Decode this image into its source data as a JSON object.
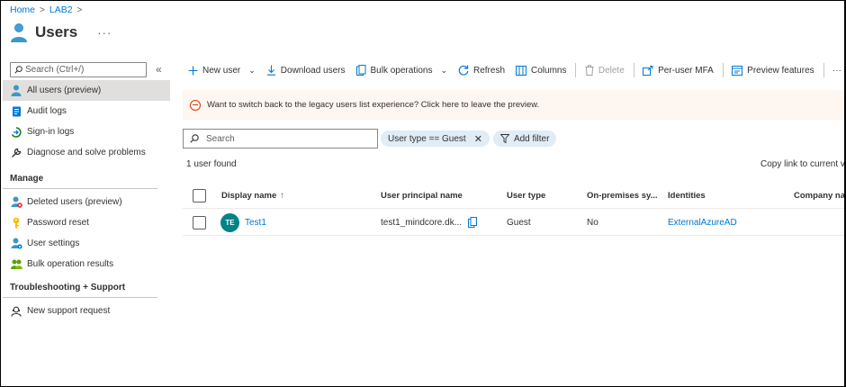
{
  "breadcrumb": {
    "home": "Home",
    "tenant": "LAB2"
  },
  "page": {
    "title": "Users",
    "more": "···"
  },
  "sidebar": {
    "search_placeholder": "Search (Ctrl+/)",
    "collapse": "«",
    "items_top": [
      {
        "label": "All users (preview)",
        "icon": "user-icon"
      },
      {
        "label": "Audit logs",
        "icon": "audit-log-icon"
      },
      {
        "label": "Sign-in logs",
        "icon": "sign-in-icon"
      },
      {
        "label": "Diagnose and solve problems",
        "icon": "wrench-icon"
      }
    ],
    "manage_heading": "Manage",
    "items_manage": [
      {
        "label": "Deleted users (preview)",
        "icon": "deleted-user-icon"
      },
      {
        "label": "Password reset",
        "icon": "key-icon"
      },
      {
        "label": "User settings",
        "icon": "user-settings-icon"
      },
      {
        "label": "Bulk operation results",
        "icon": "bulk-results-icon"
      }
    ],
    "support_heading": "Troubleshooting + Support",
    "items_support": [
      {
        "label": "New support request",
        "icon": "support-icon"
      }
    ]
  },
  "toolbar": {
    "new_user": "New user",
    "download_users": "Download users",
    "bulk_operations": "Bulk operations",
    "refresh": "Refresh",
    "columns": "Columns",
    "delete": "Delete",
    "per_user_mfa": "Per-user MFA",
    "preview_features": "Preview features",
    "more": "···"
  },
  "banner": {
    "text": "Want to switch back to the legacy users list experience? Click here to leave the preview."
  },
  "filters": {
    "search_placeholder": "Search",
    "active_filter": "User type == Guest",
    "add_filter": "Add filter"
  },
  "results": {
    "count": "1 user found",
    "copy_link": "Copy link to current vie"
  },
  "table": {
    "headers": {
      "display_name": "Display name",
      "sort": "↑",
      "upn": "User principal name",
      "user_type": "User type",
      "on_prem": "On-premises sy...",
      "identities": "Identities",
      "company": "Company nam"
    },
    "rows": [
      {
        "initials": "TE",
        "display_name": "Test1",
        "upn": "test1_mindcore.dk...",
        "user_type": "Guest",
        "on_prem": "No",
        "identities": "ExternalAzureAD"
      }
    ]
  },
  "colors": {
    "accent": "#0078d4",
    "avatar": "#038387",
    "banner_bg": "#fdf6f1",
    "pill_bg": "#e0ecf6"
  }
}
